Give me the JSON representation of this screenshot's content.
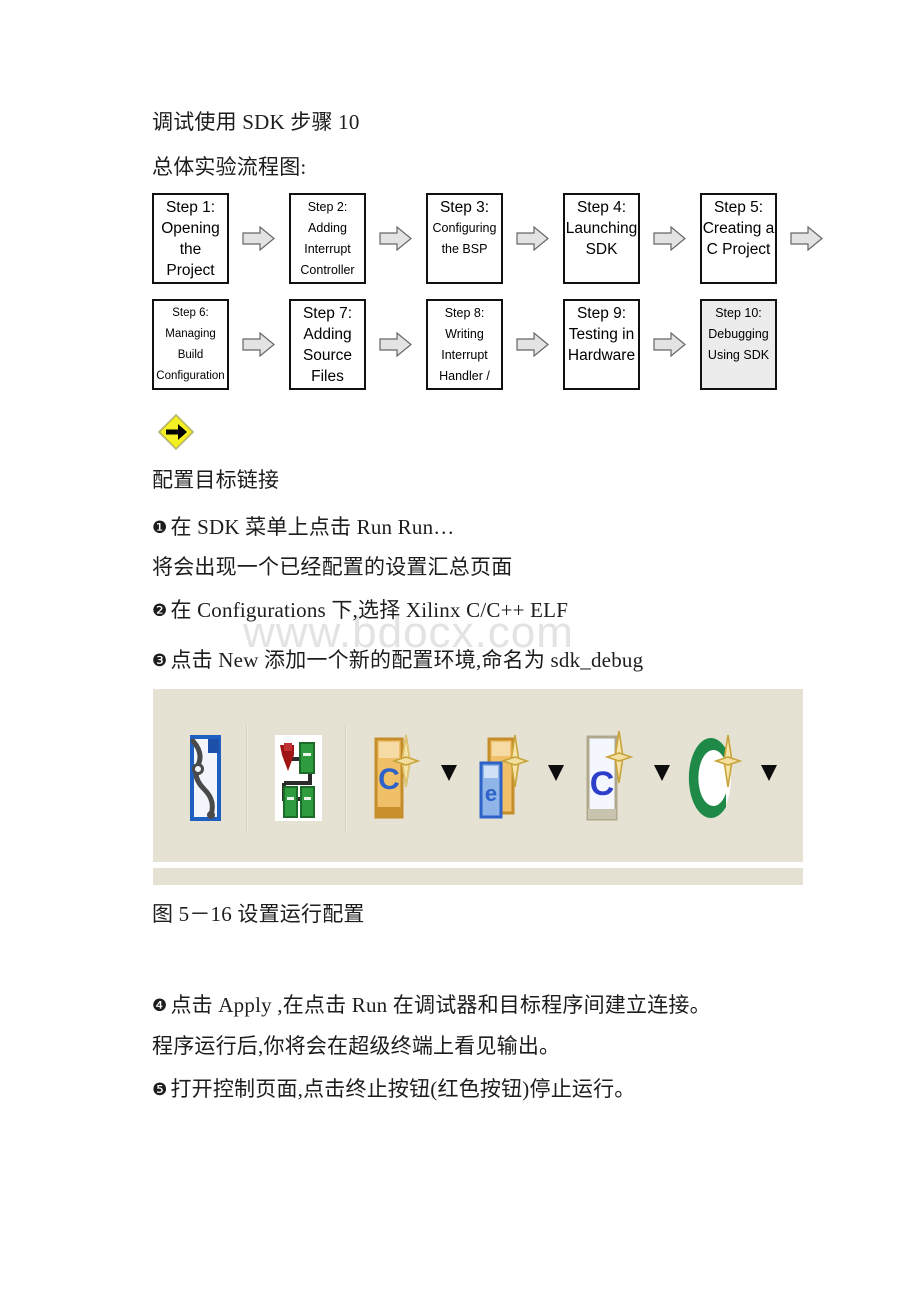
{
  "document": {
    "heading_1": "调试使用 SDK 步骤 10",
    "heading_2": "总体实验流程图:",
    "section_title": "配置目标链接",
    "steps": [
      {
        "marker": "❶",
        "text": "在 SDK 菜单上点击 Run  Run…"
      },
      {
        "marker": "",
        "text": "将会出现一个已经配置的设置汇总页面"
      },
      {
        "marker": "❷",
        "text": "在 Configurations 下,选择 Xilinx C/C++ ELF"
      },
      {
        "marker": "❸",
        "text": "点击 New 添加一个新的配置环境,命名为 sdk_debug"
      }
    ],
    "figure_caption": "图 5－16 设置运行配置",
    "steps_after": [
      {
        "marker": "❹",
        "text": "点击 Apply ,在点击 Run 在调试器和目标程序间建立连接。"
      },
      {
        "marker": "",
        "text": "程序运行后,你将会在超级终端上看见输出。"
      },
      {
        "marker": "❺",
        "text": "打开控制页面,点击终止按钮(红色按钮)停止运行。"
      }
    ],
    "watermark": "www.bdocx.com"
  },
  "flowchart": {
    "type": "process-flow",
    "rows": [
      {
        "boxes": [
          {
            "id": "step-1",
            "lines": [
              "Step 1:",
              "Opening",
              "the",
              "Project"
            ],
            "size": "big",
            "shaded": false
          },
          {
            "id": "step-2",
            "lines": [
              "Step 2:",
              "Adding",
              "Interrupt",
              "Controller"
            ],
            "size": "small",
            "shaded": false
          },
          {
            "id": "step-3",
            "lines": [
              "Step 3:",
              "Configuring",
              "the BSP"
            ],
            "size": "big",
            "shaded": false
          },
          {
            "id": "step-4",
            "lines": [
              "Step 4:",
              "Launching",
              "SDK"
            ],
            "size": "big",
            "shaded": false
          },
          {
            "id": "step-5",
            "lines": [
              "Step 5:",
              "Creating a",
              "C Project"
            ],
            "size": "big",
            "shaded": false
          }
        ],
        "arrows": 5
      },
      {
        "boxes": [
          {
            "id": "step-6",
            "lines": [
              "Step 6:",
              "Managing",
              "Build",
              "Configuration"
            ],
            "size": "tiny",
            "shaded": false
          },
          {
            "id": "step-7",
            "lines": [
              "Step 7:",
              "Adding",
              "Source",
              "Files"
            ],
            "size": "big",
            "shaded": false
          },
          {
            "id": "step-8",
            "lines": [
              "Step 8:",
              "Writing",
              "Interrupt",
              "Handler /"
            ],
            "size": "small",
            "shaded": false
          },
          {
            "id": "step-9",
            "lines": [
              "Step 9:",
              "Testing in",
              "Hardware"
            ],
            "size": "big",
            "shaded": false
          },
          {
            "id": "step-10",
            "lines": [
              "Step 10:",
              "Debugging",
              "Using SDK"
            ],
            "size": "small",
            "shaded": true
          }
        ],
        "arrows": 4
      }
    ]
  },
  "toolbar_image": {
    "caption": "图 5－16 设置运行配置",
    "background_color": "#e6e2d3",
    "buttons": [
      {
        "name": "external-tools-icon",
        "label": ""
      },
      {
        "name": "debug-configurations-icon",
        "label": ""
      },
      {
        "name": "run-c-application-icon",
        "label": ""
      },
      {
        "name": "run-external-icon",
        "label": ""
      },
      {
        "name": "debug-c-application-icon",
        "label": ""
      },
      {
        "name": "run-green-icon",
        "label": ""
      }
    ],
    "caret_count": 4
  },
  "colors": {
    "box_border": "#111111",
    "box_shaded_fill": "#ececed",
    "arrow_fill": "#e0e0e0",
    "diamond_yellow": "#f5f024",
    "watermark_gray": "#e3e3e3"
  }
}
